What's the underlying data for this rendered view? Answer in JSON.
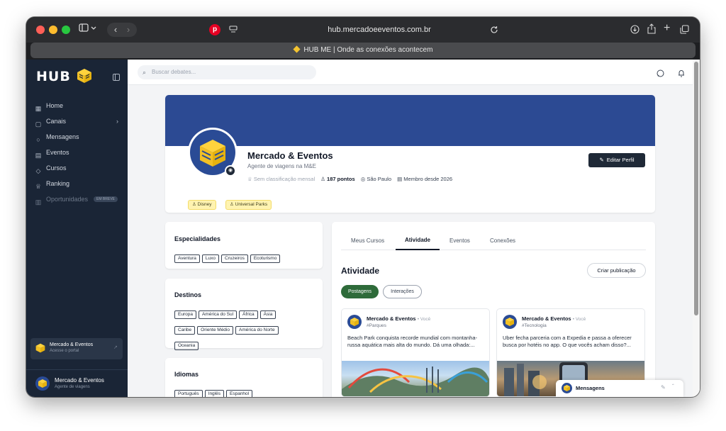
{
  "browser": {
    "url": "hub.mercadoeeventos.com.br",
    "tab_title": "HUB ME | Onde as conexões acontecem",
    "traffic_colors": [
      "#ff5f57",
      "#febc2e",
      "#28c840"
    ]
  },
  "sidebar": {
    "logo_text": "HUB",
    "items": [
      {
        "label": "Home",
        "icon": "grid-icon"
      },
      {
        "label": "Canais",
        "icon": "chat-square-icon"
      },
      {
        "label": "Mensagens",
        "icon": "chat-bubble-icon"
      },
      {
        "label": "Eventos",
        "icon": "calendar-icon"
      },
      {
        "label": "Cursos",
        "icon": "graduation-cap-icon"
      },
      {
        "label": "Ranking",
        "icon": "trophy-icon"
      },
      {
        "label": "Oportunidades",
        "icon": "briefcase-icon",
        "badge": "EM BREVE"
      }
    ],
    "portal_card": {
      "title": "Mercado & Eventos",
      "subtitle": "Acesse o portal"
    },
    "user": {
      "name": "Mercado & Eventos",
      "role": "Agente de viagens"
    }
  },
  "topbar": {
    "search_placeholder": "Buscar debates..."
  },
  "profile": {
    "name": "Mercado & Eventos",
    "subtitle": "Agente de viagens na M&E",
    "ranking": "Sem classificação mensal",
    "points": "187 pontos",
    "location": "São Paulo",
    "member_since": "Membro desde 2026",
    "edit_button": "Editar Perfil",
    "tags": [
      "Disney",
      "Universal Parks"
    ],
    "banner_color": "#2c4a93"
  },
  "specialties": {
    "title": "Especialidades",
    "tags": [
      "Aventura",
      "Luxo",
      "Cruzeiros",
      "Ecoturismo"
    ]
  },
  "destinations": {
    "title": "Destinos",
    "tags": [
      "Europa",
      "América do Sul",
      "África",
      "Ásia",
      "Caribe",
      "Oriente Médio",
      "América do Norte",
      "Oceania"
    ]
  },
  "languages": {
    "title": "Idiomas",
    "tags": [
      "Português",
      "Inglês",
      "Espanhol"
    ]
  },
  "activity": {
    "tabs": [
      "Meus Cursos",
      "Atividade",
      "Eventos",
      "Conexões"
    ],
    "active_tab": "Atividade",
    "title": "Atividade",
    "create_button": "Criar publicação",
    "filters": [
      "Postagens",
      "Interações"
    ],
    "posts": [
      {
        "author": "Mercado & Eventos",
        "you": "Você",
        "tag": "#Parques",
        "text": "Beach Park conquista recorde mundial com montanha-russa aquática mais alta do mundo. Dá uma olhada:..."
      },
      {
        "author": "Mercado & Eventos",
        "you": "Você",
        "tag": "#Tecnologia",
        "text": "Uber fecha parceria com a Expedia e passa a oferecer busca por hotéis no app. O que vocês acham disso?..."
      }
    ]
  },
  "messages_widget": {
    "label": "Mensagens"
  }
}
